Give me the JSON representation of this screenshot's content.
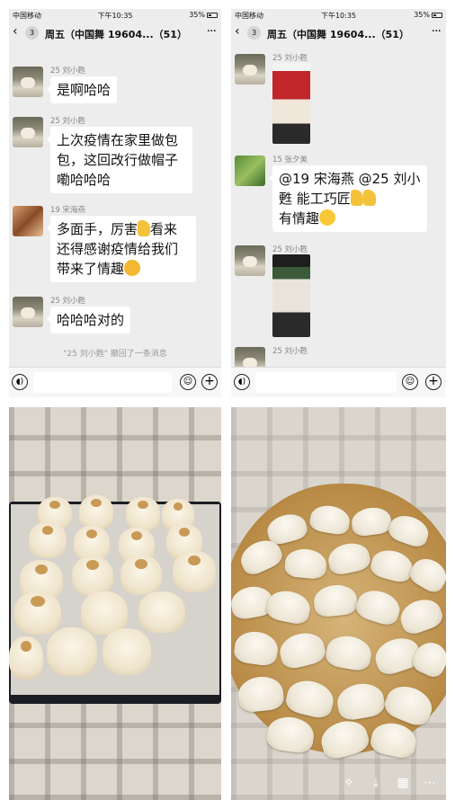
{
  "status": {
    "carrier": "中国移动",
    "time": "下午10:35",
    "battery": "35%"
  },
  "nav": {
    "badge": "3",
    "title": "周五（中国舞 19604...（51）"
  },
  "left_chat": {
    "messages": [
      {
        "sender": "25 刘小甦",
        "text": "是啊哈哈"
      },
      {
        "sender": "25 刘小甦",
        "text": "上次疫情在家里做包包，这回改行做帽子嘞哈哈哈"
      },
      {
        "sender": "19 宋海燕",
        "text_a": "多面手，厉害",
        "text_b": "看来还得感谢疫情给我们带来了情趣"
      },
      {
        "sender": "25 刘小甦",
        "text": "哈哈哈对的"
      }
    ],
    "recall_notice": "\"25 刘小甦\" 撤回了一条消息"
  },
  "right_chat": {
    "messages": [
      {
        "sender": "25 刘小甦"
      },
      {
        "sender": "15 张夕美",
        "text_a": "@19 宋海燕 @25 刘小甦 能工巧匠",
        "text_b": "有情趣"
      },
      {
        "sender": "25 刘小甦"
      },
      {
        "sender": "25 刘小甦"
      }
    ]
  },
  "icons": {
    "voice": "voice-icon",
    "emoji": "emoji-icon",
    "plus": "plus-icon"
  }
}
